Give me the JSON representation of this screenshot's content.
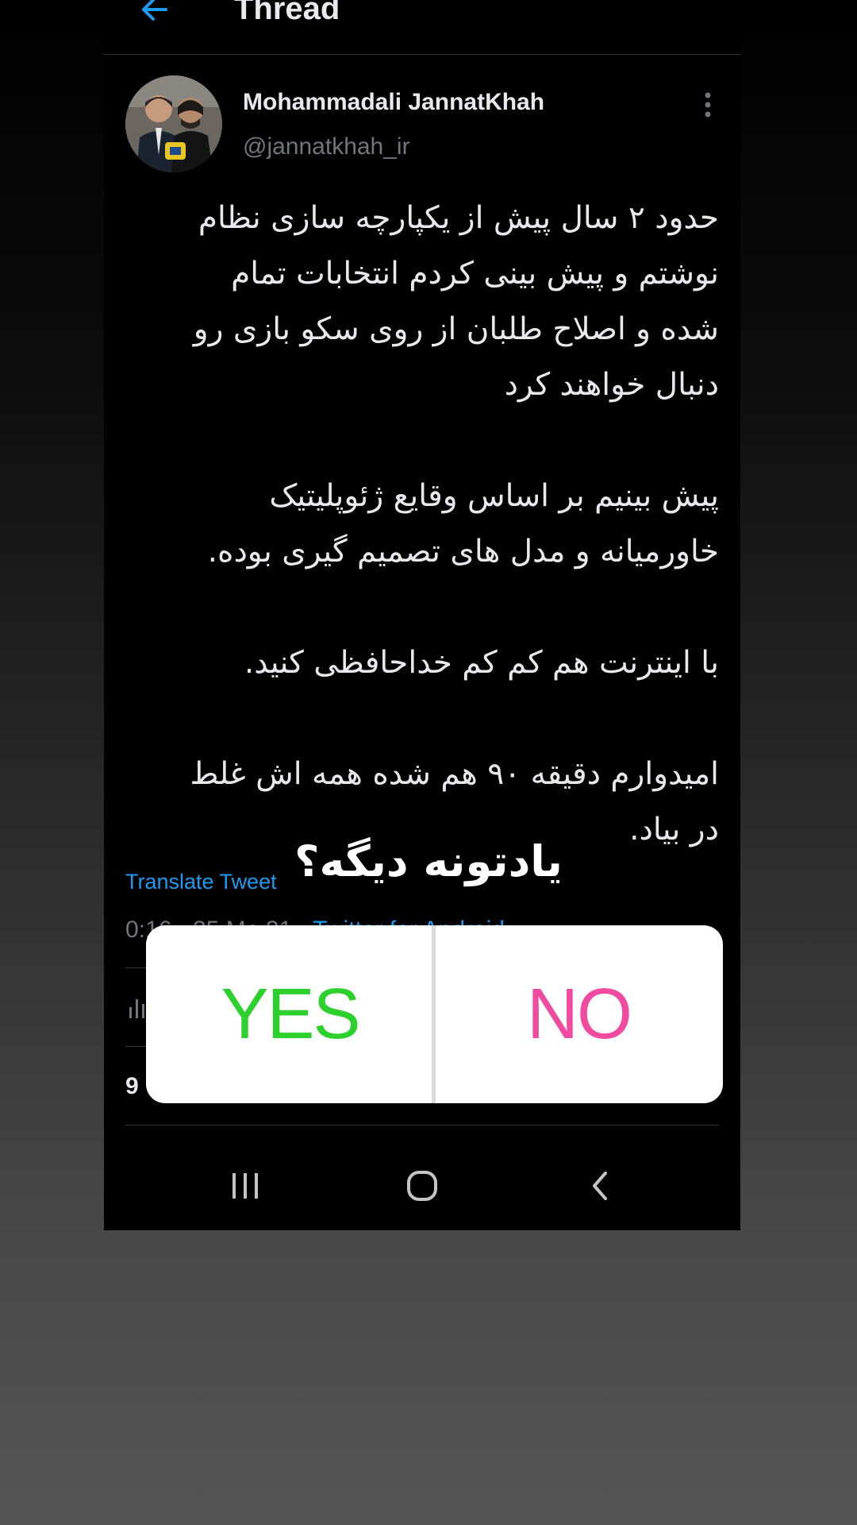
{
  "header": {
    "title": "Thread"
  },
  "author": {
    "name": "Mohammadali JannatKhah",
    "handle": "@jannatkhah_ir"
  },
  "tweet": {
    "lines": [
      "حدود ۲ سال پیش از یکپارچه سازی نظام",
      "نوشتم و پیش بینی کردم انتخابات تمام",
      "شده و اصلاح طلبان از روی سکو بازی رو",
      "دنبال خواهند کرد",
      "پیش بینیم بر اساس وقایع ژئوپلیتیک",
      "خاورمیانه و مدل های تصمیم گیری بوده.",
      "با اینترنت هم کم کم خداحافظی کنید.",
      "امیدوارم دقیقه ۹۰ هم شده همه اش غلط",
      "در بیاد."
    ],
    "translate_label": "Translate Tweet",
    "meta_partial": "0:16 · 25 Ma  21 · ",
    "client_partial": "Twitter for Android",
    "count_partial": "9"
  },
  "poll": {
    "question": "یادتونه دیگه؟",
    "yes_label": "YES",
    "no_label": "NO"
  },
  "colors": {
    "background": "#000000",
    "link": "#1d9bf0",
    "yes": "#2dd12d",
    "no": "#f04aa1"
  },
  "icons": [
    "arrow-left-icon",
    "more-vertical-icon",
    "stats-icon",
    "recent-apps-icon",
    "home-icon",
    "back-icon"
  ]
}
